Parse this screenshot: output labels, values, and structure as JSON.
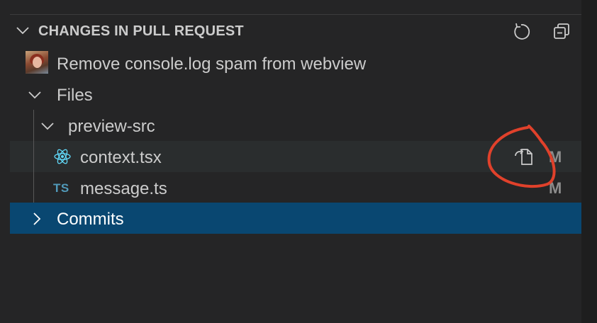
{
  "section": {
    "title": "CHANGES IN PULL REQUEST",
    "icons": [
      "refresh-icon",
      "collapse-all-icon"
    ]
  },
  "pull_request": {
    "title": "Remove console.log spam from webview"
  },
  "tree": {
    "files_label": "Files",
    "folder_label": "preview-src",
    "files": [
      {
        "name": "context.tsx",
        "status": "M",
        "icon": "react-icon"
      },
      {
        "name": "message.ts",
        "status": "M",
        "icon": "TS"
      }
    ],
    "commits_label": "Commits"
  },
  "colors": {
    "background": "#252526",
    "selection": "#094771",
    "hover": "#2a2d2e",
    "annotation": "#e0412b",
    "typescript": "#519aba",
    "react": "#61dafb"
  }
}
